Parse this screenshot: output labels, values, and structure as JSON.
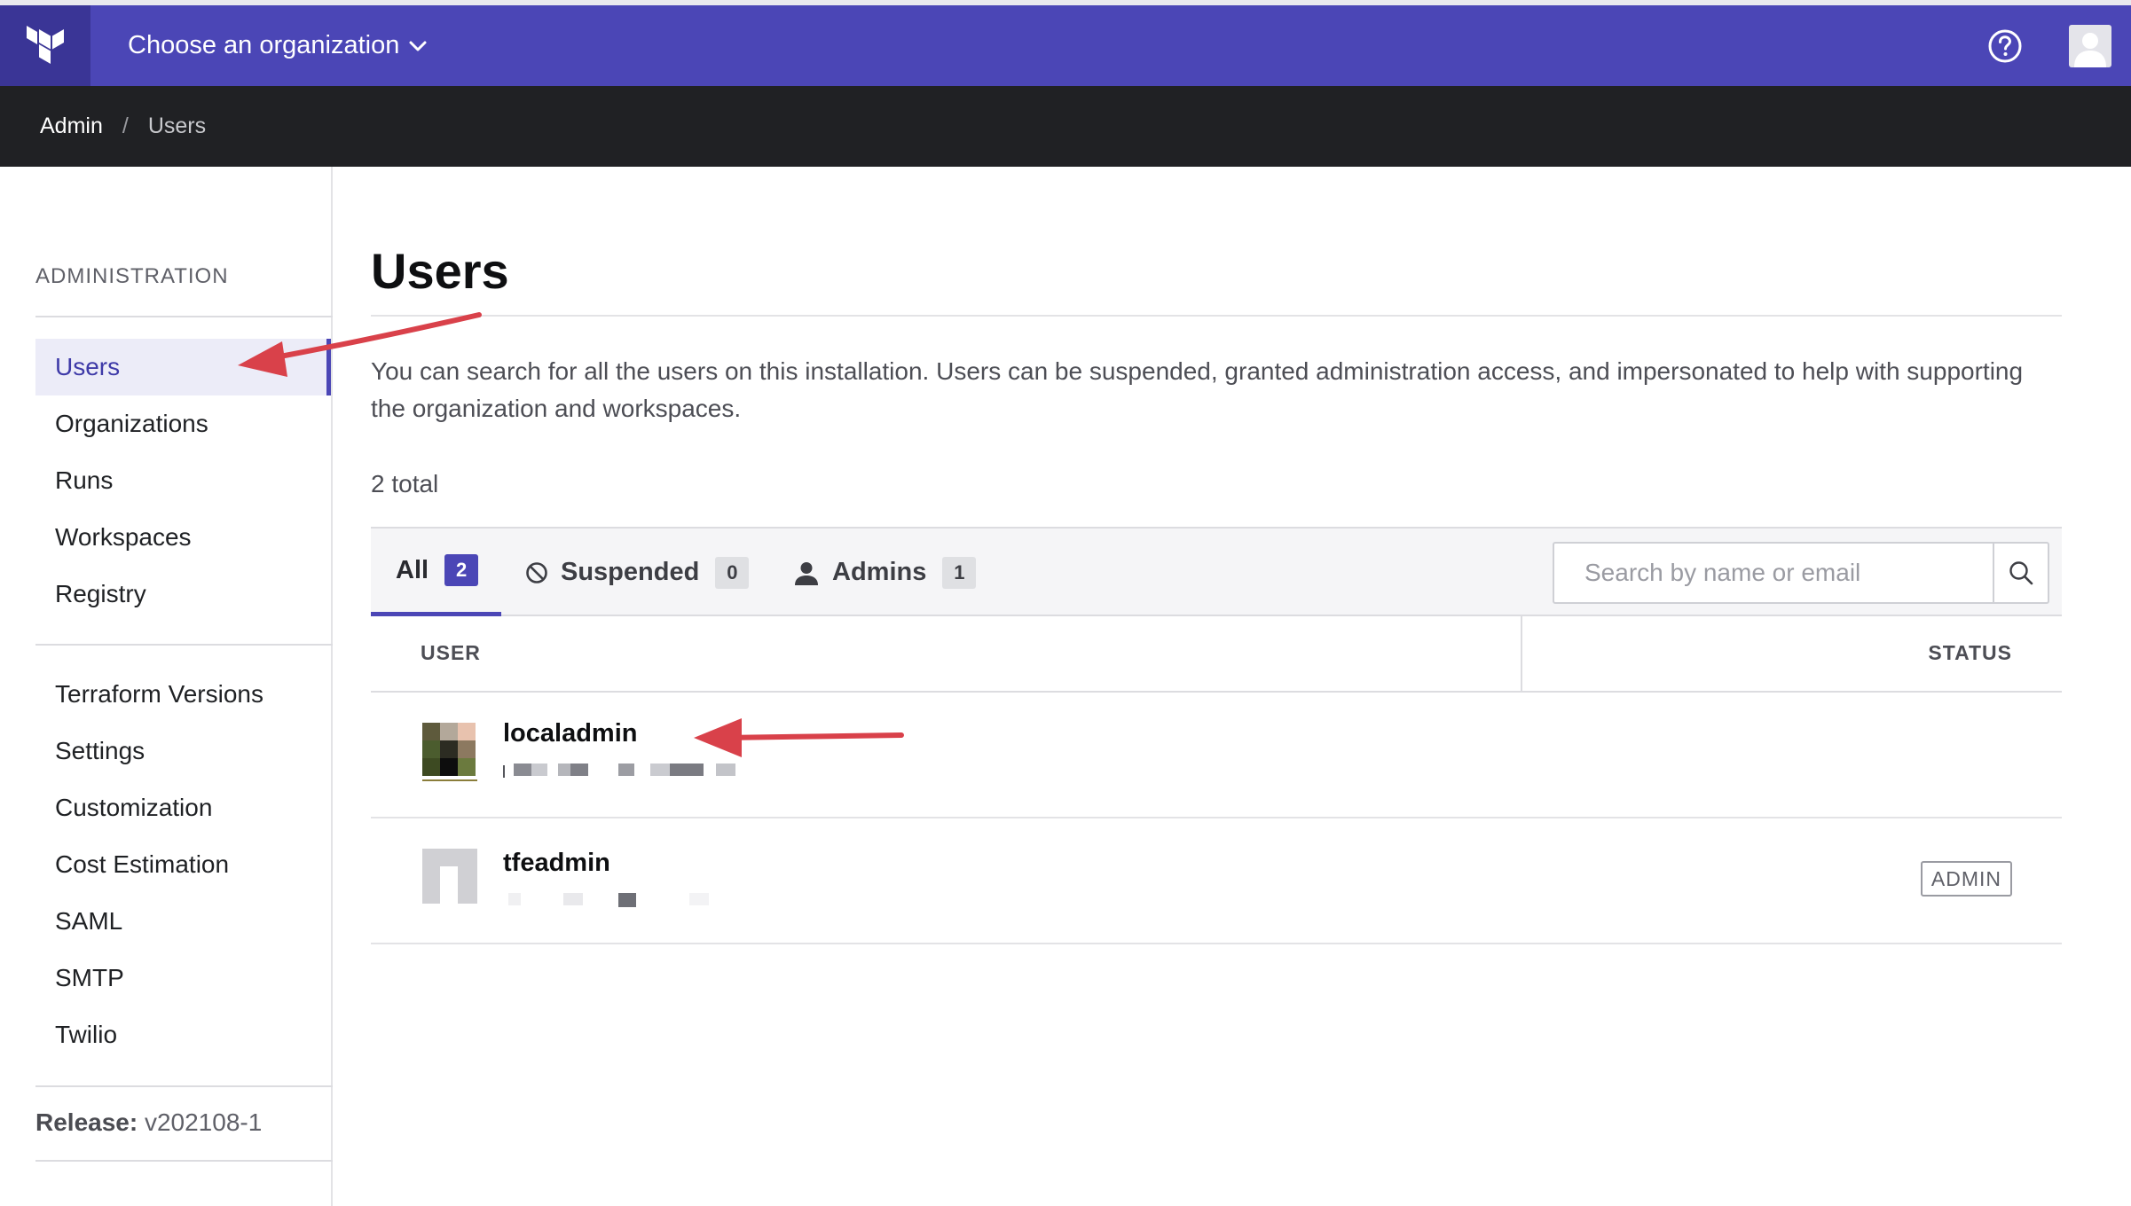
{
  "topbar": {
    "org_switcher_label": "Choose an organization"
  },
  "breadcrumb": {
    "items": [
      "Admin",
      "Users"
    ],
    "separator": "/"
  },
  "sidebar": {
    "heading": "ADMINISTRATION",
    "primary_items": [
      {
        "label": "Users",
        "active": true
      },
      {
        "label": "Organizations",
        "active": false
      },
      {
        "label": "Runs",
        "active": false
      },
      {
        "label": "Workspaces",
        "active": false
      },
      {
        "label": "Registry",
        "active": false
      }
    ],
    "secondary_items": [
      {
        "label": "Terraform Versions"
      },
      {
        "label": "Settings"
      },
      {
        "label": "Customization"
      },
      {
        "label": "Cost Estimation"
      },
      {
        "label": "SAML"
      },
      {
        "label": "SMTP"
      },
      {
        "label": "Twilio"
      }
    ],
    "release_label": "Release:",
    "release_value": "v202108-1"
  },
  "main": {
    "title": "Users",
    "description": "You can search for all the users on this installation. Users can be suspended, granted administration access, and impersonated to help with supporting the organization and workspaces.",
    "total": "2 total",
    "tabs": [
      {
        "label": "All",
        "count": "2",
        "active": true,
        "icon": null
      },
      {
        "label": "Suspended",
        "count": "0",
        "active": false,
        "icon": "prohibited-icon"
      },
      {
        "label": "Admins",
        "count": "1",
        "active": false,
        "icon": "person-icon"
      }
    ],
    "search": {
      "placeholder": "Search by name or email"
    },
    "table": {
      "columns": [
        "USER",
        "STATUS"
      ],
      "rows": [
        {
          "name": "localadmin",
          "email": "",
          "status": ""
        },
        {
          "name": "tfeadmin",
          "email": "",
          "status": "ADMIN"
        }
      ]
    }
  },
  "colors": {
    "topbar": "#4b46b6",
    "breadcrumb_bar": "#202124",
    "accent": "#4b46b6",
    "annotation_arrow": "#d9414a"
  }
}
